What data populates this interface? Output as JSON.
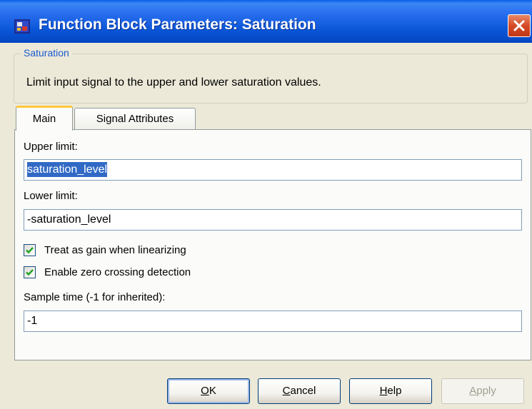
{
  "window": {
    "title": "Function Block Parameters: Saturation"
  },
  "group": {
    "legend": "Saturation",
    "description": "Limit input signal to the upper and lower saturation values."
  },
  "tabs": [
    {
      "label": "Main",
      "active": true
    },
    {
      "label": "Signal Attributes",
      "active": false
    }
  ],
  "form": {
    "upper_limit_label": "Upper limit:",
    "upper_limit_value": "saturation_level",
    "lower_limit_label": "Lower limit:",
    "lower_limit_value": "-saturation_level",
    "treat_gain_label": "Treat as gain when linearizing",
    "treat_gain_checked": true,
    "zero_crossing_label": "Enable zero crossing detection",
    "zero_crossing_checked": true,
    "sample_time_label": "Sample time (-1 for inherited):",
    "sample_time_value": "-1"
  },
  "buttons": {
    "ok_mnemonic": "O",
    "ok_rest": "K",
    "cancel_mnemonic": "C",
    "cancel_rest": "ancel",
    "help_mnemonic": "H",
    "help_rest": "elp",
    "apply_prefix": "",
    "apply_mnemonic": "A",
    "apply_rest": "pply"
  },
  "colors": {
    "titlebar": "#0a56d8",
    "legend_text": "#1b59d1",
    "selection": "#316ac5",
    "active_tab_accent": "#ffc83c",
    "close_button": "#d54a26"
  },
  "icons": {
    "window_icon": "simulink-block-icon",
    "close": "close-icon",
    "checkmark": "checkmark-icon"
  }
}
